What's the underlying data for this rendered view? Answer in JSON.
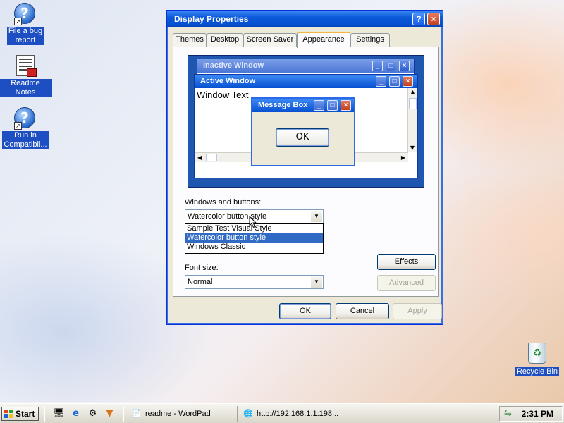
{
  "desktop": {
    "icons": [
      {
        "label_line1": "File a bug",
        "label_line2": "report"
      },
      {
        "label_line1": "Readme Notes"
      },
      {
        "label_line1": "Run in",
        "label_line2": "Compatibil..."
      },
      {
        "label_line1": "Recycle Bin"
      }
    ]
  },
  "dialog": {
    "title": "Display Properties",
    "help_glyph": "?",
    "close_glyph": "×",
    "tabs": [
      "Themes",
      "Desktop",
      "Screen Saver",
      "Appearance",
      "Settings"
    ],
    "active_tab": "Appearance",
    "preview": {
      "inactive_title": "Inactive Window",
      "active_title": "Active Window",
      "window_text": "Window Text",
      "message_box_title": "Message Box",
      "message_ok": "OK"
    },
    "windows_buttons_label": "Windows and buttons:",
    "windows_buttons_value": "Watercolor button style",
    "windows_buttons_options": [
      "Sample Test Visual Style",
      "Watercolor button style",
      "Windows Classic"
    ],
    "selected_option_index": 1,
    "font_size_label": "Font size:",
    "font_size_value": "Normal",
    "effects_label": "Effects",
    "advanced_label": "Advanced",
    "ok_label": "OK",
    "cancel_label": "Cancel",
    "apply_label": "Apply"
  },
  "taskbar": {
    "start_label": "Start",
    "quick_launch_icons": [
      "show-desktop-icon",
      "internet-explorer-icon",
      "network-icon",
      "media-player-icon"
    ],
    "tasks": [
      {
        "label": "readme - WordPad",
        "icon": "wordpad-icon"
      },
      {
        "label": "http://192.168.1.1:198...",
        "icon": "browser-icon"
      }
    ],
    "clock": "2:31 PM"
  },
  "colors": {
    "title_blue": "#0650d0",
    "selection_blue": "#316ac5",
    "dialog_face": "#ece9d8",
    "preview_desktop": "#1e56b0"
  }
}
